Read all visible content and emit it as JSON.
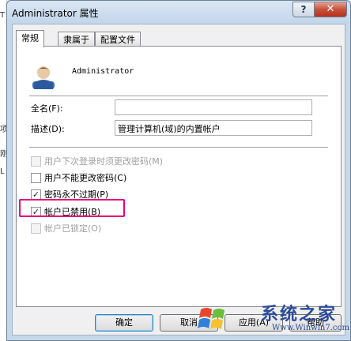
{
  "background_text": [
    "T",
    "项",
    "刚",
    "L"
  ],
  "window": {
    "title": "Administrator 属性",
    "help_label": "?",
    "close_label": "✕"
  },
  "tabs": [
    {
      "label": "常规",
      "active": true
    },
    {
      "label": "隶属于",
      "active": false
    },
    {
      "label": "配置文件",
      "active": false
    }
  ],
  "user": {
    "name": "Administrator"
  },
  "fields": {
    "fullname": {
      "label": "全名(F):",
      "value": ""
    },
    "description": {
      "label": "描述(D):",
      "value": "管理计算机(域)的内置帐户"
    }
  },
  "checkboxes": [
    {
      "label": "用户下次登录时须更改密码(M)",
      "checked": false,
      "disabled": true
    },
    {
      "label": "用户不能更改密码(C)",
      "checked": false,
      "disabled": false
    },
    {
      "label": "密码永不过期(P)",
      "checked": true,
      "disabled": false
    },
    {
      "label": "帐户已禁用(B)",
      "checked": true,
      "disabled": false
    },
    {
      "label": "帐户已锁定(O)",
      "checked": false,
      "disabled": true
    }
  ],
  "buttons": {
    "ok": "确定",
    "cancel": "取消",
    "apply": "应用(A)",
    "help": "帮助"
  },
  "watermark": {
    "text": "系统之家",
    "url": "Www.Winwin7.com"
  },
  "colors": {
    "highlight": "#e5007e",
    "close_button": "#c6513a"
  }
}
